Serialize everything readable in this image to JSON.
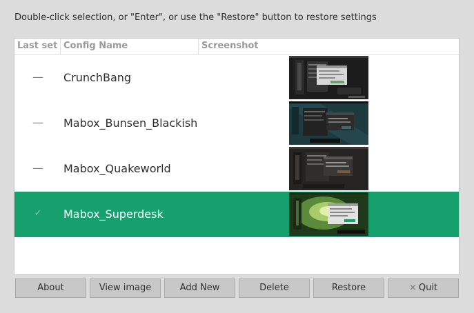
{
  "instructions": "Double-click selection, or \"Enter\", or use the \"Restore\" button to restore settings",
  "table": {
    "headers": {
      "last_set": "Last set",
      "config_name": "Config Name",
      "screenshot": "Screenshot"
    },
    "rows": [
      {
        "mark": "—",
        "name": "CrunchBang",
        "selected": false
      },
      {
        "mark": "—",
        "name": "Mabox_Bunsen_Blackish",
        "selected": false
      },
      {
        "mark": "—",
        "name": "Mabox_Quakeworld",
        "selected": false
      },
      {
        "mark": "✓",
        "name": "Mabox_Superdesk",
        "selected": true
      }
    ]
  },
  "buttons": {
    "about": "About",
    "view_image": "View image",
    "add_new": "Add New",
    "delete": "Delete",
    "restore": "Restore",
    "quit": "Quit",
    "quit_icon": "×"
  },
  "colors": {
    "selection": "#16a06e",
    "background": "#dcdcdc"
  }
}
